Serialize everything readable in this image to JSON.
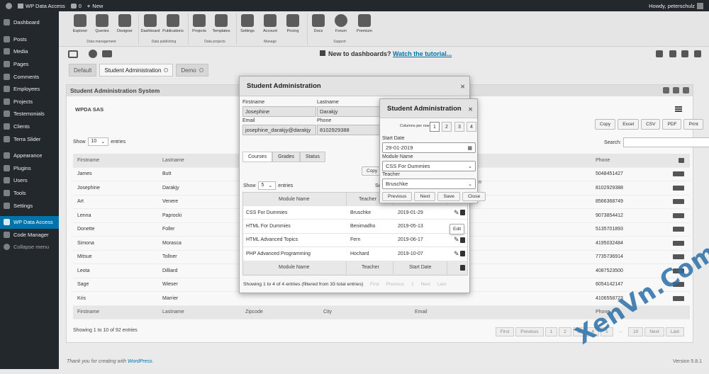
{
  "adminbar": {
    "site": "WP Data Access",
    "comments": "0",
    "new": "New",
    "howdy": "Howdy, peterschulz"
  },
  "sidebar": [
    {
      "label": "Dashboard",
      "icon": "dashboard-icon"
    },
    {
      "label": "Posts",
      "icon": "pin-icon"
    },
    {
      "label": "Media",
      "icon": "media-icon"
    },
    {
      "label": "Pages",
      "icon": "page-icon"
    },
    {
      "label": "Comments",
      "icon": "comment-icon"
    },
    {
      "label": "Employees",
      "icon": "users-icon"
    },
    {
      "label": "Projects",
      "icon": "folder-icon"
    },
    {
      "label": "Testemonials",
      "icon": "quote-icon"
    },
    {
      "label": "Clients",
      "icon": "client-icon"
    },
    {
      "label": "Terra Slider",
      "icon": "slider-icon"
    },
    {
      "label": "Appearance",
      "icon": "brush-icon"
    },
    {
      "label": "Plugins",
      "icon": "plug-icon"
    },
    {
      "label": "Users",
      "icon": "user-icon"
    },
    {
      "label": "Tools",
      "icon": "wrench-icon"
    },
    {
      "label": "Settings",
      "icon": "settings-icon"
    },
    {
      "label": "WP Data Access",
      "icon": "database-icon"
    },
    {
      "label": "Code Manager",
      "icon": "code-icon"
    },
    {
      "label": "Collapse menu",
      "icon": "collapse-icon"
    }
  ],
  "toolbar": {
    "buttons": [
      "Explorer",
      "Queries",
      "Designer",
      "Dashboard",
      "Publications",
      "Projects",
      "Templates",
      "Settings",
      "Account",
      "Pricing",
      "Docs",
      "Forum",
      "Premium"
    ],
    "groups": [
      "Data management",
      "Data publishing",
      "Data projects",
      "Manage",
      "Support"
    ]
  },
  "tutorial": {
    "text": "New to dashboards?",
    "link": "Watch the tutorial..."
  },
  "tabs": [
    "Default",
    "Student Administration",
    "Demo"
  ],
  "panel": {
    "title": "Student Administration System",
    "subtitle": "WPDA SAS",
    "export": [
      "Copy",
      "Excel",
      "CSV",
      "PDF",
      "Print"
    ],
    "show": "Show",
    "entries_sel": "10",
    "entries": "entries",
    "search": "Search:",
    "info": "Showing 1 to 10 of 92 entries",
    "pages": [
      "First",
      "Previous",
      "1",
      "2",
      "3",
      "4",
      "5",
      "...",
      "10",
      "Next",
      "Last"
    ]
  },
  "bg_table": {
    "headers": [
      "Firstname",
      "Lastname",
      "Zipcode",
      "City",
      "Email",
      "Phone"
    ],
    "rows": [
      {
        "first": "James",
        "last": "Butt",
        "phone": "5048451427"
      },
      {
        "first": "Josephine",
        "last": "Darakjy",
        "phone": "8102929388"
      },
      {
        "first": "Art",
        "last": "Venere",
        "phone": "8566368749"
      },
      {
        "first": "Lenna",
        "last": "Paprocki",
        "phone": "9073854412"
      },
      {
        "first": "Donette",
        "last": "Foller",
        "phone": "5135701893"
      },
      {
        "first": "Simona",
        "last": "Morasca",
        "phone": "4195032484"
      },
      {
        "first": "Mitsue",
        "last": "Tollner",
        "phone": "7735736914"
      },
      {
        "first": "Leota",
        "last": "Dilliard",
        "phone": "4087523500"
      },
      {
        "first": "Sage",
        "last": "Wieser",
        "phone": "6054142147"
      },
      {
        "first": "Kris",
        "last": "Marrier",
        "phone": "4106558723"
      }
    ]
  },
  "dialog1": {
    "title": "Student Administration",
    "firstname_label": "Firstname",
    "firstname": "Josephine",
    "lastname_label": "Lastname",
    "lastname": "Darakjy",
    "email_label": "Email",
    "email": "josephine_darakjy@darakjy",
    "phone_label": "Phone",
    "phone": "8102929388",
    "tabs": [
      "Courses",
      "Grades",
      "Status"
    ],
    "copy": "Copy",
    "show": "Show",
    "entries_sel": "5",
    "entries": "entries",
    "search_partial": "Se",
    "headers": [
      "Module Name",
      "Teacher",
      "Start Date"
    ],
    "rows": [
      {
        "module": "CSS For Dummies",
        "teacher": "Bruschke",
        "date": "2019-01-29"
      },
      {
        "module": "HTML For Dummies",
        "teacher": "Benimadho",
        "date": "2019-05-13"
      },
      {
        "module": "HTML Advanced Topics",
        "teacher": "Fern",
        "date": "2019-06-17"
      },
      {
        "module": "PHP Advanced Programming",
        "teacher": "Hochard",
        "date": "2019-10-07"
      }
    ],
    "info": "Showing 1 to 4 of 4 entries (filtered from 33 total entries)",
    "pages": [
      "First",
      "Previous",
      "1",
      "Next",
      "Last"
    ]
  },
  "dialog2": {
    "title": "Student Administration",
    "columns": "Columns per row",
    "nums": [
      "1",
      "2",
      "3",
      "4"
    ],
    "start_label": "Start Date",
    "start": "29-01-2019",
    "module_label": "Module Name",
    "module": "CSS For Dummies",
    "teacher_label": "Teacher",
    "teacher": "Bruschke",
    "buttons": [
      "Previous",
      "Next",
      "Save",
      "Close"
    ]
  },
  "tooltip": "Edit",
  "bg_partial": {
    "row2_city": "n",
    "row2_last": "A"
  },
  "footer": {
    "text": "Thank you for creating with",
    "link": "WordPress",
    "version": "Version 5.8.1"
  },
  "watermark": "XenVn.Com"
}
